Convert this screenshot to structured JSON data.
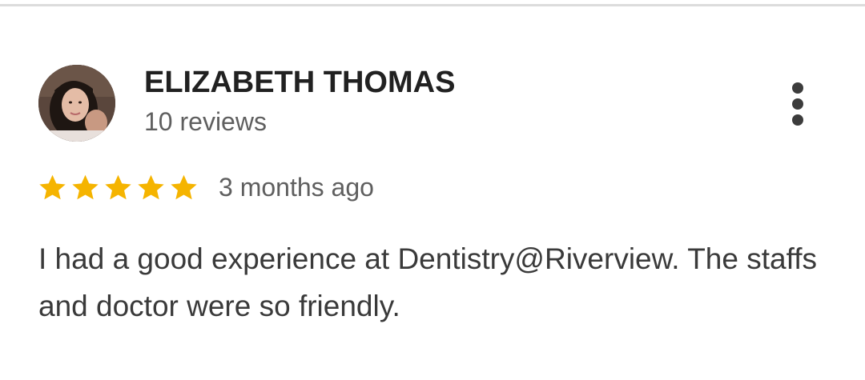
{
  "review": {
    "reviewer_name": "ELIZABETH THOMAS",
    "review_count": "10 reviews",
    "rating": 5,
    "rating_max": 5,
    "timestamp": "3 months ago",
    "text": "I had a good experience at Dentistry@Riverview. The staffs and doctor were so friendly."
  },
  "icons": {
    "more": "more-vertical-icon",
    "star": "star-icon"
  },
  "colors": {
    "star": "#F5B400",
    "name": "#212121",
    "secondary_text": "#5F5F5F",
    "body_text": "#3A3A3A",
    "divider": "#DCDCDC"
  }
}
